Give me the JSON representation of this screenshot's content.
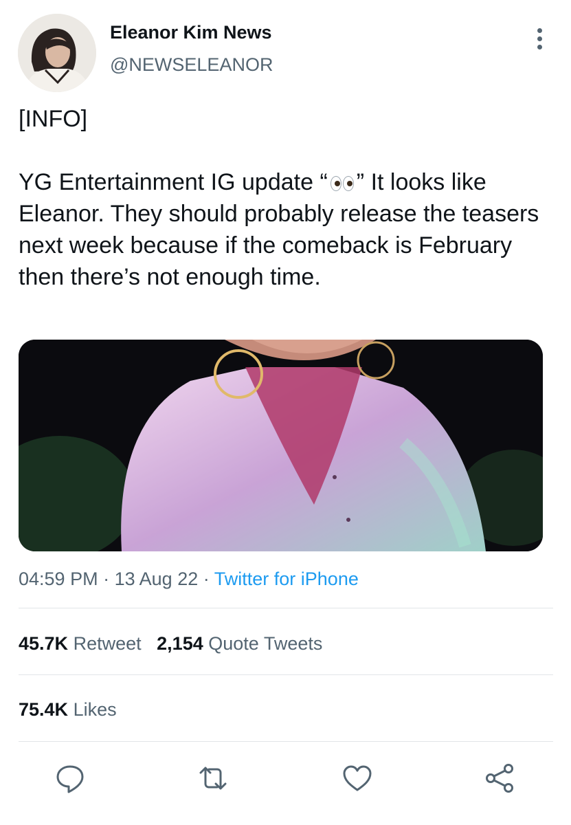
{
  "author": {
    "display_name": "Eleanor Kim News",
    "handle": "@NEWSELEANOR",
    "avatar_icon": "profile-photo"
  },
  "tweet": {
    "tag_line": "[INFO]",
    "text_before_emoji": "YG Entertainment IG update “",
    "emoji_icon": "eyes-emoji",
    "text_after_emoji": "” It looks like Eleanor. They should probably release the teasers next week because if the comeback is February then there’s not enough time.",
    "media_description_icon": "photo"
  },
  "meta": {
    "time": "04:59 PM",
    "separator": "·",
    "date": "13 Aug 22",
    "source": "Twitter for iPhone"
  },
  "stats": {
    "retweets_count": "45.7K",
    "retweets_label": "Retweet",
    "quotes_count": "2,154",
    "quotes_label": "Quote Tweets",
    "likes_count": "75.4K",
    "likes_label": "Likes"
  },
  "actions": {
    "reply_icon": "reply-icon",
    "retweet_icon": "retweet-icon",
    "like_icon": "heart-icon",
    "share_icon": "share-icon"
  },
  "colors": {
    "text": "#0f1419",
    "secondary": "#536471",
    "link": "#1d9bf0",
    "divider": "#e1e5e8"
  }
}
